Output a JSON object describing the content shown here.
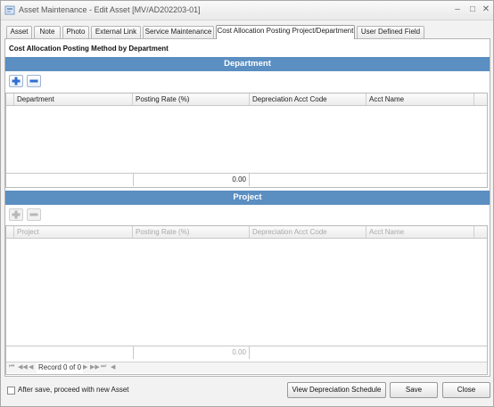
{
  "window": {
    "title": "Asset Maintenance - Edit Asset [MV/AD202203-01]",
    "minimize_glyph": "–",
    "maximize_glyph": "□",
    "close_glyph": "✕"
  },
  "tabs": [
    {
      "label": "Asset",
      "active": false
    },
    {
      "label": "Note",
      "active": false
    },
    {
      "label": "Photo",
      "active": false
    },
    {
      "label": "External Link",
      "active": false
    },
    {
      "label": "Service Maintenance",
      "active": false
    },
    {
      "label": "Cost Allocation Posting Project/Department",
      "active": true
    },
    {
      "label": "User Defined Field",
      "active": false
    }
  ],
  "section_heading": "Cost Allocation Posting Method by Department",
  "department": {
    "bar_title": "Department",
    "columns": [
      "Department",
      "Posting Rate (%)",
      "Depreciation Acct Code",
      "Acct Name"
    ],
    "total": "0.00"
  },
  "project": {
    "bar_title": "Project",
    "columns": [
      "Project",
      "Posting Rate (%)",
      "Depreciation Acct Code",
      "Acct Name"
    ],
    "total": "0.00",
    "navigator": {
      "record_label": "Record 0 of 0"
    }
  },
  "footer": {
    "checkbox_label": "After save, proceed with new Asset",
    "checked": false,
    "buttons": {
      "view_schedule": "View Depreciation Schedule",
      "save": "Save",
      "close": "Close"
    }
  },
  "colors": {
    "bar_blue": "#5b8ec1",
    "add_icon_blue": "#2f6fd0"
  },
  "icons": [
    "app-icon",
    "add-icon",
    "remove-icon",
    "first-record-icon",
    "prev-page-icon",
    "prev-record-icon",
    "next-record-icon",
    "next-page-icon",
    "last-record-icon",
    "scroll-left-icon"
  ]
}
